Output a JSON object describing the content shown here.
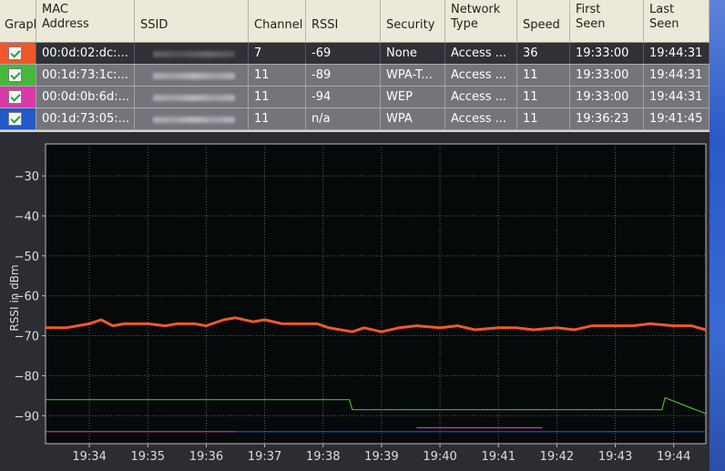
{
  "table": {
    "columns": [
      {
        "key": "graph",
        "label": "Graph"
      },
      {
        "key": "mac",
        "label": "MAC\nAddress"
      },
      {
        "key": "ssid",
        "label": "SSID"
      },
      {
        "key": "channel",
        "label": "Channel"
      },
      {
        "key": "rssi",
        "label": "RSSI"
      },
      {
        "key": "security",
        "label": "Security"
      },
      {
        "key": "type",
        "label": "Network\nType"
      },
      {
        "key": "speed",
        "label": "Speed"
      },
      {
        "key": "first",
        "label": "First\nSeen"
      },
      {
        "key": "last",
        "label": "Last\nSeen"
      }
    ],
    "rows": [
      {
        "color": "#f0582a",
        "checked": true,
        "mac": "00:0d:02:dc:...",
        "channel": "7",
        "rssi": "-69",
        "security": "None",
        "type": "Access ...",
        "speed": "36",
        "first": "19:33:00",
        "last": "19:44:31",
        "selected": true
      },
      {
        "color": "#46b83b",
        "checked": true,
        "mac": "00:1d:73:1c:...",
        "channel": "11",
        "rssi": "-89",
        "security": "WPA-T...",
        "type": "Access ...",
        "speed": "11",
        "first": "19:33:00",
        "last": "19:44:31",
        "selected": false
      },
      {
        "color": "#d83aa8",
        "checked": true,
        "mac": "00:0d:0b:6d:...",
        "channel": "11",
        "rssi": "-94",
        "security": "WEP",
        "type": "Access ...",
        "speed": "11",
        "first": "19:33:00",
        "last": "19:44:31",
        "selected": false
      },
      {
        "color": "#2358c8",
        "checked": true,
        "mac": "00:1d:73:05:...",
        "channel": "11",
        "rssi": "n/a",
        "security": "WPA",
        "type": "Access ...",
        "speed": "11",
        "first": "19:36:23",
        "last": "19:41:45",
        "selected": false
      }
    ]
  },
  "chart_data": {
    "type": "line",
    "ylabel": "RSSI in dBm",
    "yticks": [
      -30,
      -40,
      -50,
      -60,
      -70,
      -80,
      -90
    ],
    "ylim": [
      -22,
      -97
    ],
    "xticks": [
      "19:34",
      "19:35",
      "19:36",
      "19:37",
      "19:38",
      "19:39",
      "19:40",
      "19:41",
      "19:42",
      "19:43",
      "19:44"
    ],
    "xlim_minutes": [
      33.25,
      44.55
    ],
    "grid": true,
    "series": [
      {
        "color": "#f0582a",
        "x": [
          33.25,
          33.6,
          33.8,
          34.0,
          34.2,
          34.4,
          34.6,
          34.8,
          35.0,
          35.3,
          35.5,
          35.8,
          36.0,
          36.3,
          36.5,
          36.8,
          37.0,
          37.3,
          37.6,
          37.9,
          38.1,
          38.3,
          38.5,
          38.7,
          39.0,
          39.3,
          39.6,
          40.0,
          40.3,
          40.6,
          41.0,
          41.3,
          41.6,
          42.0,
          42.3,
          42.6,
          43.0,
          43.3,
          43.6,
          44.0,
          44.3,
          44.55
        ],
        "y": [
          -68,
          -68,
          -67.5,
          -67,
          -66,
          -67.5,
          -67,
          -67,
          -67,
          -67.5,
          -67,
          -67,
          -67.5,
          -66,
          -65.5,
          -66.5,
          -66,
          -67,
          -67,
          -67,
          -68,
          -68.5,
          -69,
          -68,
          -69,
          -68,
          -67.5,
          -68,
          -67.5,
          -68.5,
          -68,
          -68,
          -68.5,
          -68,
          -68.5,
          -67.5,
          -67.5,
          -67.5,
          -67,
          -67.5,
          -67.5,
          -68.5
        ]
      },
      {
        "color": "#46b83b",
        "x": [
          33.25,
          38.45,
          38.5,
          43.8,
          43.85,
          44.55
        ],
        "y": [
          -86,
          -86,
          -88.5,
          -88.5,
          -85.5,
          -89.5
        ]
      },
      {
        "color": "#d83aa8",
        "x": [
          33.25,
          36.5
        ],
        "y": [
          -94,
          -94
        ]
      },
      {
        "color": "#d83aa8",
        "x": [
          39.6,
          41.75
        ],
        "y": [
          -93,
          -93
        ]
      },
      {
        "color": "#2358c8",
        "x": [
          36.5,
          44.55
        ],
        "y": [
          -94,
          -94
        ]
      }
    ]
  }
}
